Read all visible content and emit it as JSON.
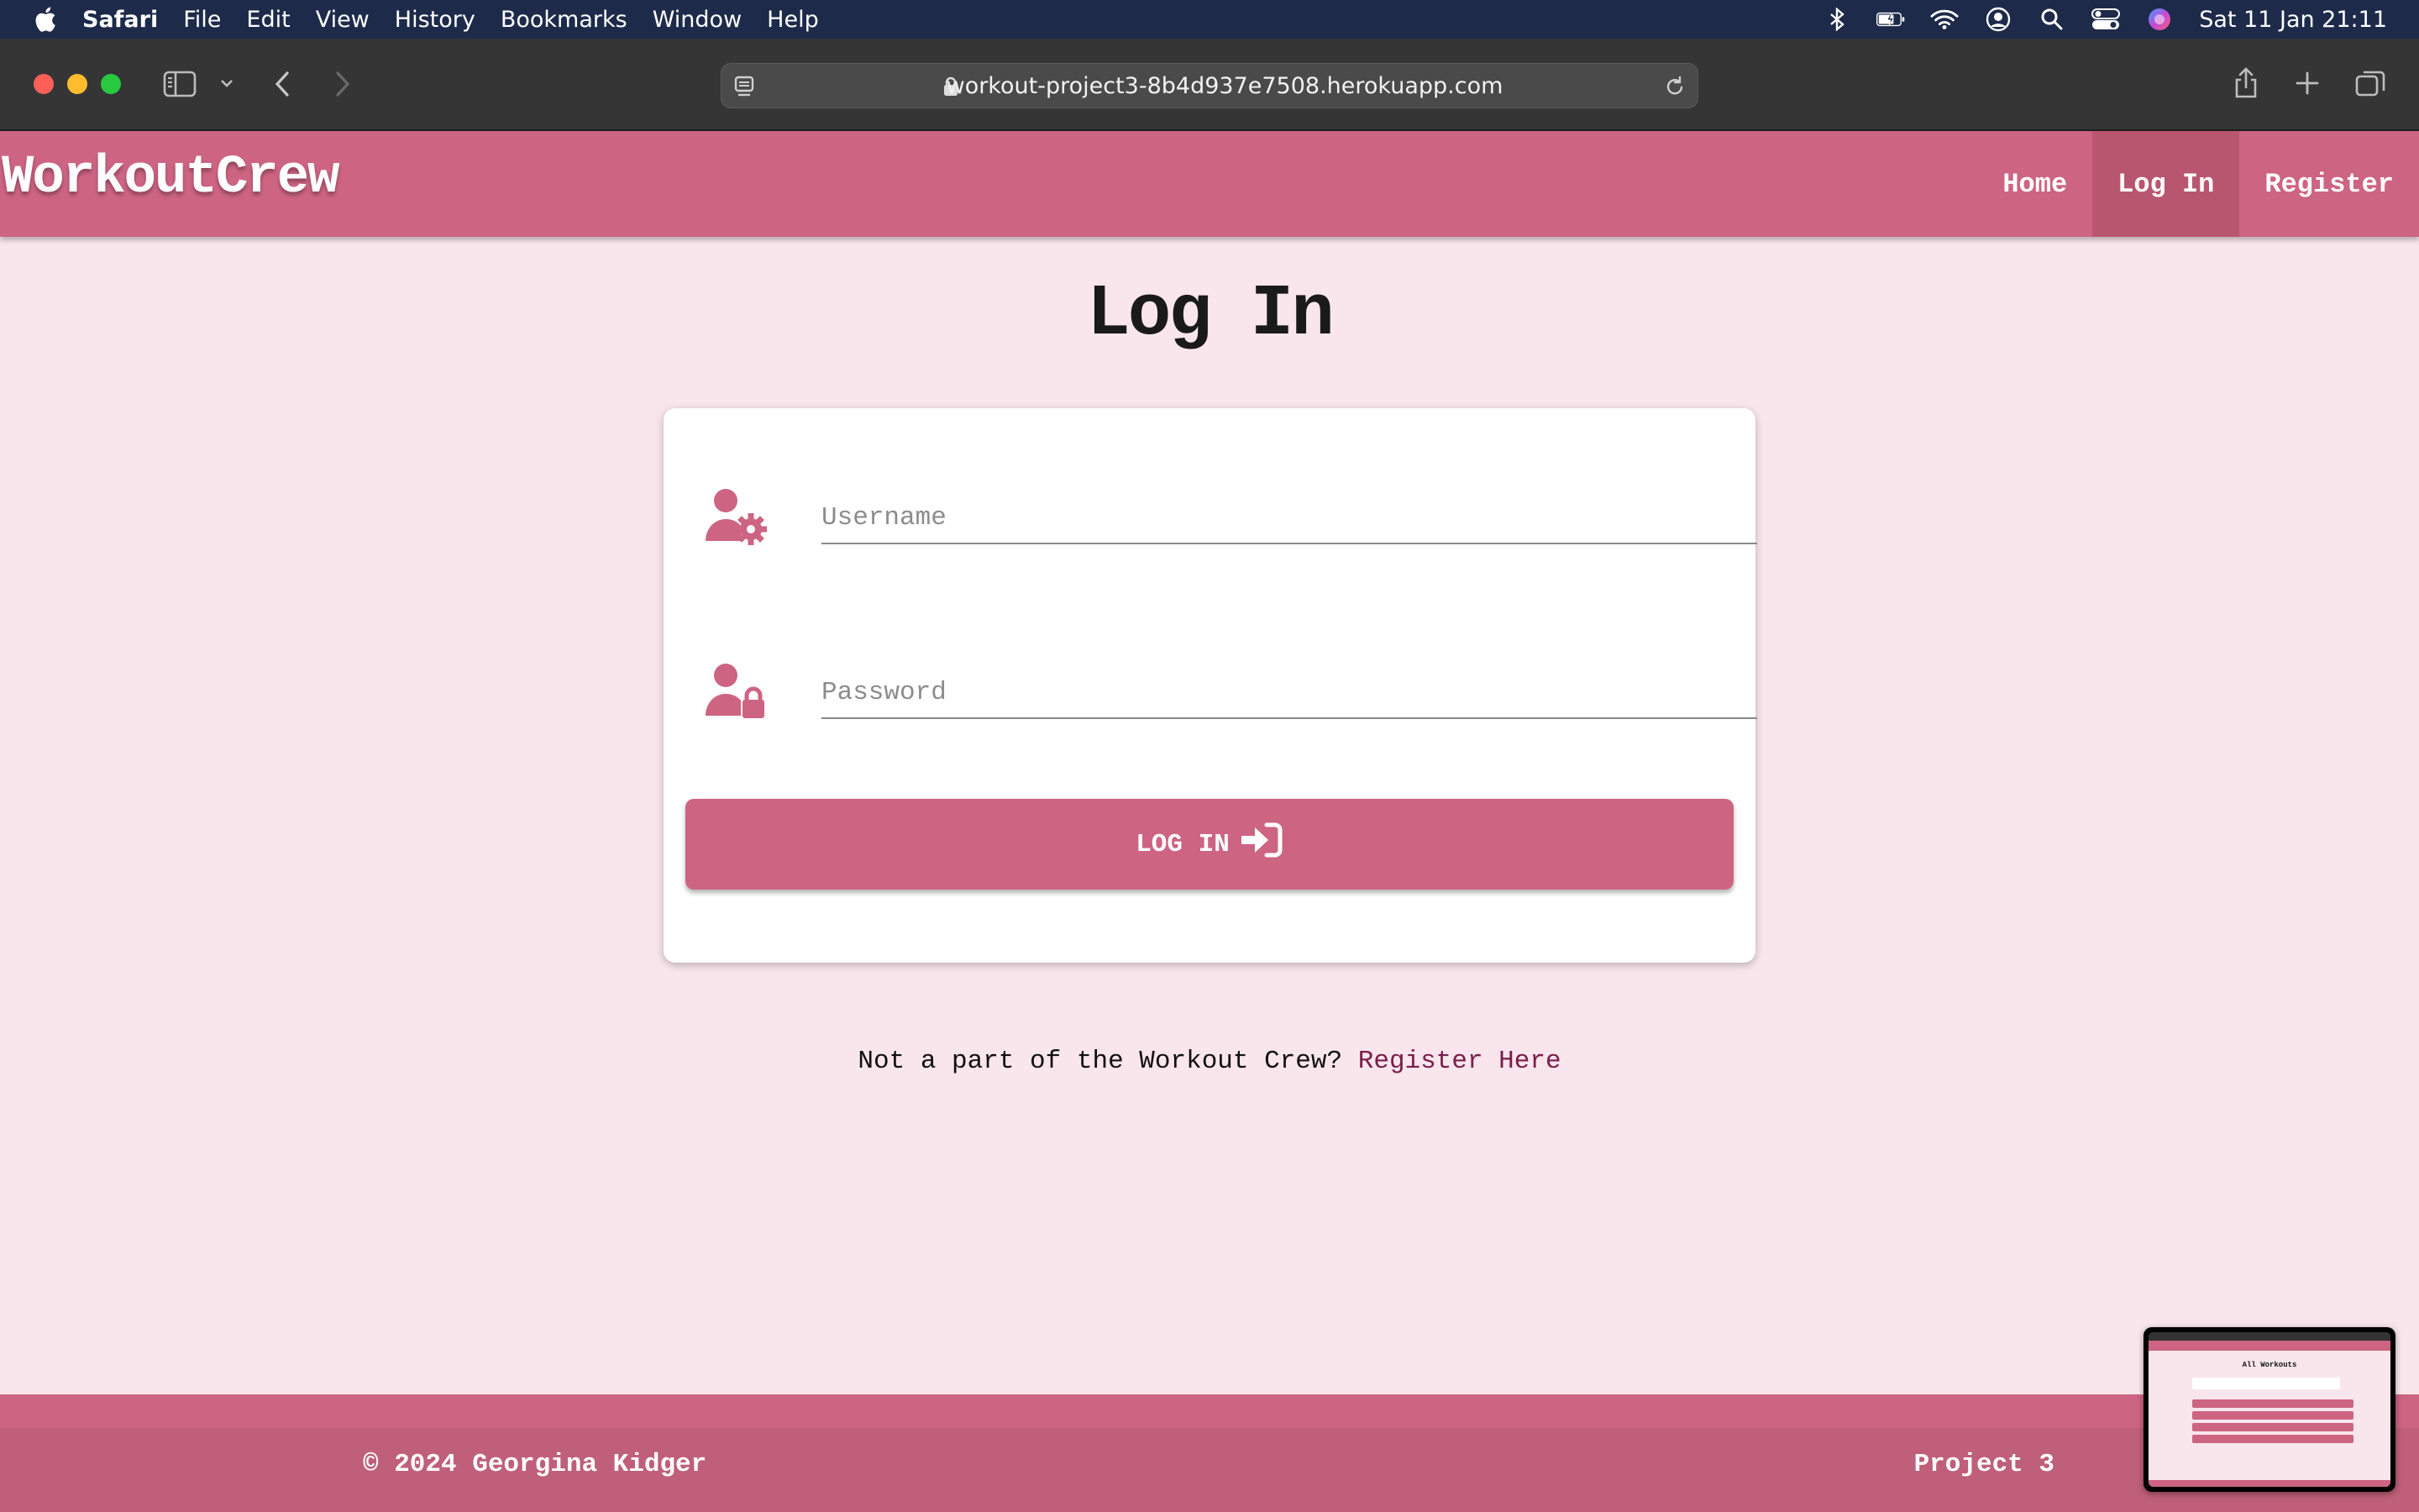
{
  "menubar": {
    "app_name": "Safari",
    "items": [
      "File",
      "Edit",
      "View",
      "History",
      "Bookmarks",
      "Window",
      "Help"
    ],
    "clock": "Sat 11 Jan  21:11"
  },
  "browser": {
    "url": "workout-project3-8b4d937e7508.herokuapp.com"
  },
  "site": {
    "brand": "WorkoutCrew",
    "nav": [
      {
        "label": "Home"
      },
      {
        "label": "Log In"
      },
      {
        "label": "Register"
      }
    ]
  },
  "main": {
    "title": "Log In",
    "username_placeholder": "Username",
    "password_placeholder": "Password",
    "login_label": "LOG IN",
    "register_prompt": "Not a part of the Workout Crew?",
    "register_link": "Register Here"
  },
  "footer": {
    "copyright": "© 2024 Georgina Kidger",
    "project": "Project 3"
  },
  "thumbnail": {
    "title": "All Workouts"
  },
  "colors": {
    "brand_pink": "#cd6482",
    "page_bg": "#f9e6ec",
    "link": "#7a1d4a"
  }
}
